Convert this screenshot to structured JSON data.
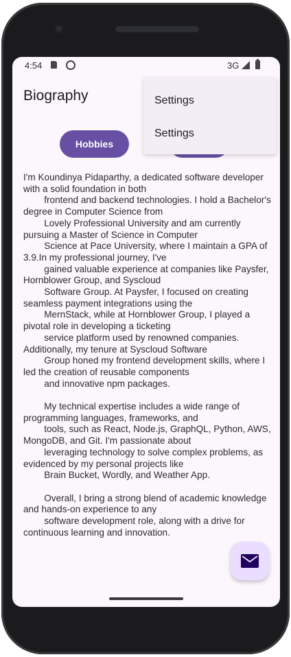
{
  "status_bar": {
    "time": "4:54",
    "network": "3G"
  },
  "app_bar": {
    "title": "Biography"
  },
  "buttons": {
    "hobbies": "Hobbies"
  },
  "menu": {
    "items": [
      "Settings",
      "Settings"
    ]
  },
  "bio_text": "I'm Koundinya Pidaparthy, a dedicated software developer with a solid foundation in both\n        frontend and backend technologies. I hold a Bachelor's degree in Computer Science from\n        Lovely Professional University and am currently pursuing a Master of Science in Computer\n        Science at Pace University, where I maintain a GPA of 3.9.In my professional journey, I've\n        gained valuable experience at companies like Paysfer, Hornblower Group, and Syscloud\n        Software Group. At Paysfer, I focused on creating seamless payment integrations using the\n        MernStack, while at Hornblower Group, I played a pivotal role in developing a ticketing\n        service platform used by renowned companies. Additionally, my tenure at Syscloud Software\n        Group honed my frontend development skills, where I led the creation of reusable components\n        and innovative npm packages.\n\n        My technical expertise includes a wide range of programming languages, frameworks, and\n        tools, such as React, Node.js, GraphQL, Python, AWS, MongoDB, and Git. I'm passionate about\n        leveraging technology to solve complex problems, as evidenced by my personal projects like\n        Brain Bucket, Wordly, and Weather App.\n\n        Overall, I bring a strong blend of academic knowledge and hands-on experience to any\n        software development role, along with a drive for continuous learning and innovation.",
  "fab": {
    "icon": "mail-icon"
  },
  "colors": {
    "primary": "#6750a4",
    "fab_background": "#eaddff",
    "menu_background": "#f3edf6",
    "screen_background": "#fcf7fc",
    "fab_icon": "#21005d"
  }
}
